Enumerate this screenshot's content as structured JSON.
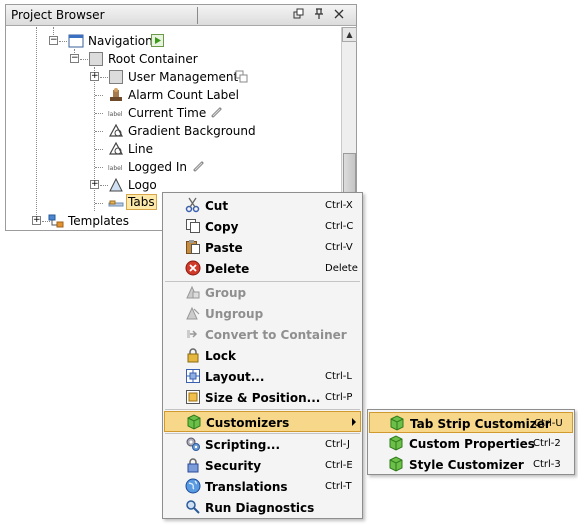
{
  "panel": {
    "title": "Project Browser",
    "buttons": [
      "restore",
      "pin",
      "close"
    ],
    "tree": {
      "navigation": {
        "label": "Navigation"
      },
      "root_container": {
        "label": "Root Container"
      },
      "children": [
        {
          "label": "User Management",
          "icon": "container-icon",
          "badge": "link-badge-icon"
        },
        {
          "label": "Alarm Count Label",
          "icon": "label-icon"
        },
        {
          "label": "Current Time",
          "icon": "text-label-icon",
          "badge": "binding-link-icon"
        },
        {
          "label": "Gradient Background",
          "icon": "shape-icon"
        },
        {
          "label": "Line",
          "icon": "shape-icon"
        },
        {
          "label": "Logged In",
          "icon": "text-label-icon",
          "badge": "binding-link-icon"
        },
        {
          "label": "Logo",
          "icon": "image-icon"
        },
        {
          "label": "Tabs",
          "icon": "tab-strip-icon",
          "selected": true
        }
      ],
      "templates": {
        "label": "Templates"
      }
    }
  },
  "context_menu": {
    "items": [
      {
        "label": "Cut",
        "shortcut": "Ctrl-X",
        "icon": "scissors-icon",
        "enabled": true
      },
      {
        "label": "Copy",
        "shortcut": "Ctrl-C",
        "icon": "copy-icon",
        "enabled": true
      },
      {
        "label": "Paste",
        "shortcut": "Ctrl-V",
        "icon": "paste-icon",
        "enabled": true
      },
      {
        "label": "Delete",
        "shortcut": "Delete",
        "icon": "delete-icon",
        "enabled": true
      },
      {
        "label": "Group",
        "shortcut": "",
        "icon": "group-icon",
        "enabled": false
      },
      {
        "label": "Ungroup",
        "shortcut": "",
        "icon": "ungroup-icon",
        "enabled": false
      },
      {
        "label": "Convert to Container",
        "shortcut": "",
        "icon": "convert-icon",
        "enabled": false
      },
      {
        "label": "Lock",
        "shortcut": "",
        "icon": "lock-icon",
        "enabled": true
      },
      {
        "label": "Layout...",
        "shortcut": "Ctrl-L",
        "icon": "layout-icon",
        "enabled": true
      },
      {
        "label": "Size & Position...",
        "shortcut": "Ctrl-P",
        "icon": "size-position-icon",
        "enabled": true
      },
      {
        "label": "Customizers",
        "shortcut": "",
        "icon": "customizer-icon",
        "enabled": true,
        "submenu": true,
        "highlighted": true
      },
      {
        "label": "Scripting...",
        "shortcut": "Ctrl-J",
        "icon": "scripting-icon",
        "enabled": true
      },
      {
        "label": "Security",
        "shortcut": "Ctrl-E",
        "icon": "security-icon",
        "enabled": true
      },
      {
        "label": "Translations",
        "shortcut": "Ctrl-T",
        "icon": "translations-icon",
        "enabled": true
      },
      {
        "label": "Run Diagnostics",
        "shortcut": "",
        "icon": "diagnostics-icon",
        "enabled": true
      }
    ]
  },
  "customizers_submenu": {
    "items": [
      {
        "label": "Tab Strip Customizer",
        "shortcut": "Ctrl-U",
        "icon": "customizer-icon",
        "highlighted": true
      },
      {
        "label": "Custom Properties",
        "shortcut": "Ctrl-2",
        "icon": "customizer-icon"
      },
      {
        "label": "Style Customizer",
        "shortcut": "Ctrl-3",
        "icon": "customizer-icon"
      }
    ]
  },
  "colors": {
    "highlight": "#f7d88a",
    "highlight_border": "#d09a2f",
    "disabled_text": "#8f8f8f",
    "menu_bg": "#f4f4f4"
  }
}
